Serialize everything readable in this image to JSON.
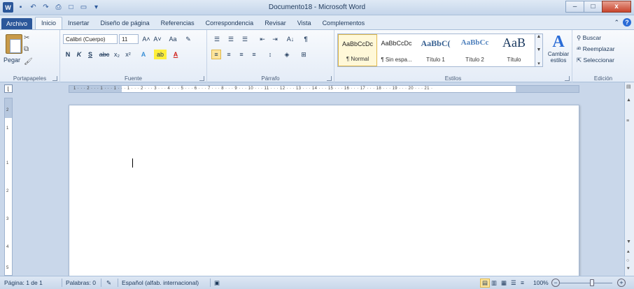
{
  "window": {
    "title": "Documento18 - Microsoft Word",
    "min": "–",
    "max": "□",
    "close": "x"
  },
  "qat": {
    "word": "W",
    "save": "▪",
    "undo": "↶",
    "redo": "↷",
    "preview": "⎙",
    "new": "□",
    "open": "▭",
    "more": "▾"
  },
  "tabs": [
    "Archivo",
    "Inicio",
    "Insertar",
    "Diseño de página",
    "Referencias",
    "Correspondencia",
    "Revisar",
    "Vista",
    "Complementos"
  ],
  "tabs_right": {
    "minimize": "⌃",
    "help": "?"
  },
  "clipboard": {
    "paste": "Pegar",
    "group": "Portapapeles"
  },
  "font": {
    "name": "Calibri (Cuerpo)",
    "size": "11",
    "grow": "A˄",
    "shrink": "A˅",
    "case": "Aa",
    "clear": "✎",
    "bold": "N",
    "italic": "K",
    "underline": "S",
    "strike": "abc",
    "sub": "x₂",
    "sup": "x²",
    "effects": "A",
    "highlight": "ab",
    "color": "A",
    "group": "Fuente"
  },
  "paragraph": {
    "bullets": "☰",
    "numbering": "☰",
    "multilevel": "☰",
    "dec_indent": "⇤",
    "inc_indent": "⇥",
    "sort": "A↓",
    "marks": "¶",
    "align_left": "≡",
    "align_center": "≡",
    "align_right": "≡",
    "justify": "≡",
    "line_spacing": "↕",
    "shading": "◈",
    "borders": "⊞",
    "group": "Párrafo"
  },
  "styles": {
    "items": [
      {
        "preview": "AaBbCcDc",
        "name": "¶ Normal"
      },
      {
        "preview": "AaBbCcDc",
        "name": "¶ Sin espa..."
      },
      {
        "preview": "AaBbC(",
        "name": "Título 1"
      },
      {
        "preview": "AaBbCc",
        "name": "Título 2"
      },
      {
        "preview": "AaB",
        "name": "Título"
      }
    ],
    "change": "Cambiar",
    "change2": "estilos",
    "group": "Estilos"
  },
  "editing": {
    "find": "Buscar",
    "replace": "Reemplazar",
    "select": "Seleccionar",
    "group": "Edición"
  },
  "ruler": {
    "text": "1 · · · 2 · · · 1 · · · 1 · · · 1 · · · 2 · · · 3 · · · 4 · · · 5 · · · 6 · · · 7 · · · 8 · · · 9 · · · 10 · · · 11 · · · 12 · · · 13 · · · 14 · · · 15 · · · 16 · · · 17 · · · 18 · · · 19 · · · 20 · · · 21 ·",
    "vticks": [
      "2",
      "1",
      "1",
      "2",
      "3",
      "4",
      "5"
    ]
  },
  "status": {
    "page": "Página: 1 de 1",
    "words": "Palabras: 0",
    "language": "Español (alfab. internacional)",
    "zoom": "100%",
    "zoom_out": "−",
    "zoom_in": "+"
  }
}
